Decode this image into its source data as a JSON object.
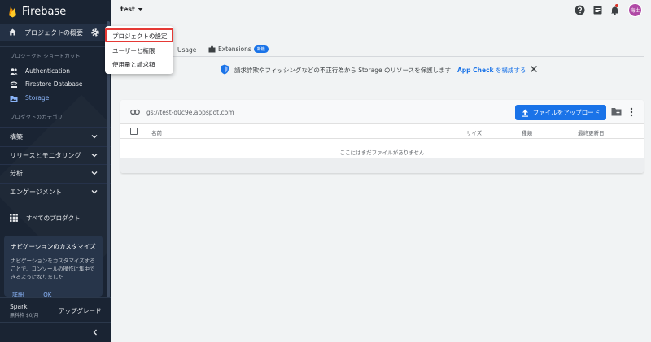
{
  "app": {
    "brand": "Firebase"
  },
  "sidebar": {
    "overview_label": "プロジェクトの概要",
    "shortcuts_title": "プロジェクト ショートカット",
    "shortcuts": [
      {
        "label": "Authentication",
        "icon": "people-icon"
      },
      {
        "label": "Firestore Database",
        "icon": "wifi-database-icon"
      },
      {
        "label": "Storage",
        "icon": "folder-image-icon",
        "active": true
      }
    ],
    "categories_title": "プロダクトのカテゴリ",
    "categories": [
      {
        "label": "構築"
      },
      {
        "label": "リリースとモニタリング"
      },
      {
        "label": "分析"
      },
      {
        "label": "エンゲージメント"
      }
    ],
    "all_products_label": "すべてのプロダクト",
    "customize_card": {
      "title": "ナビゲーションのカスタマイズ",
      "body": "ナビゲーションをカスタマイズすることで、コンソールの操作に集中できるようになりました",
      "details_link": "詳細",
      "ok_link": "OK"
    },
    "plan": {
      "name": "Spark",
      "price": "無料枠 $0/月",
      "upgrade_label": "アップグレード"
    }
  },
  "header": {
    "project_name": "test",
    "avatar_initials": "海士"
  },
  "dropdown": {
    "items": [
      {
        "label": "プロジェクトの設定",
        "highlighted": true
      },
      {
        "label": "ユーザーと権限"
      },
      {
        "label": "使用量と請求額"
      }
    ]
  },
  "tabs": {
    "usage_label": "Usage",
    "extensions_label": "Extensions",
    "extensions_badge": "新機"
  },
  "banner": {
    "text": "請求詐欺やフィッシングなどの不正行為から Storage のリソースを保護します",
    "link_strong": "App Check",
    "link_rest": " を構成する"
  },
  "storage": {
    "bucket_path": "gs://test-d0c9e.appspot.com",
    "upload_label": "ファイルをアップロード",
    "columns": {
      "name": "名前",
      "size": "サイズ",
      "type": "種類",
      "modified": "最終更新日"
    },
    "empty_message": "ここにはまだファイルがありません"
  },
  "colors": {
    "sidebar_bg": "#1a2433",
    "accent": "#1a73e8",
    "highlight_outline": "#e53935",
    "avatar_bg": "#b04aa6"
  }
}
